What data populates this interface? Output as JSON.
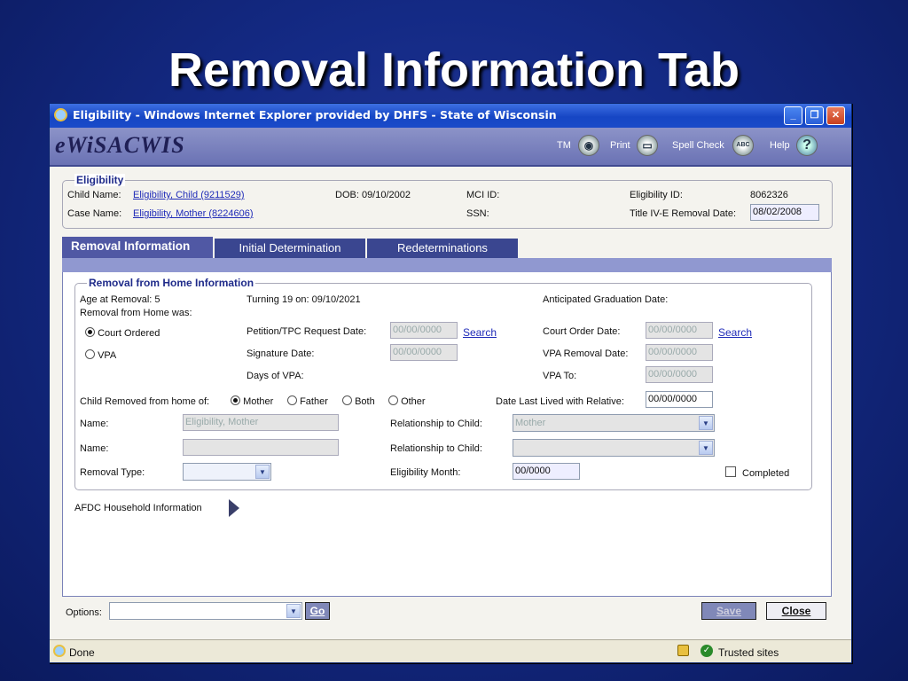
{
  "slide": {
    "title": "Removal Information Tab"
  },
  "window": {
    "title": "Eligibility - Windows Internet Explorer provided by DHFS - State of Wisconsin"
  },
  "app": {
    "logo": "eWiSACWIS",
    "toolbar": {
      "tm": "TM",
      "print": "Print",
      "spell": "Spell Check",
      "help": "Help"
    }
  },
  "header": {
    "legend": "Eligibility",
    "child_name_label": "Child Name:",
    "child_name": "Eligibility, Child (9211529)",
    "case_name_label": "Case Name:",
    "case_name": "Eligibility, Mother (8224606)",
    "dob": "DOB: 09/10/2002",
    "mci": "MCI ID:",
    "ssn": "SSN:",
    "elig_id_label": "Eligibility ID:",
    "elig_id": "8062326",
    "title4e_label": "Title IV-E Removal Date:",
    "title4e_value": "08/02/2008"
  },
  "tabs": {
    "removal": "Removal Information",
    "initial": "Initial Determination",
    "redet": "Redeterminations"
  },
  "removal": {
    "legend": "Removal from Home Information",
    "age": "Age at Removal: 5",
    "turning": "Turning 19 on: 09/10/2021",
    "anticipated": "Anticipated Graduation Date:",
    "removal_was": "Removal from Home was:",
    "court_ordered": "Court Ordered",
    "vpa": "VPA",
    "petition_label": "Petition/TPC Request Date:",
    "petition_value": "00/00/0000",
    "search1": "Search",
    "court_order_label": "Court Order Date:",
    "court_order_value": "00/00/0000",
    "search2": "Search",
    "signature_label": "Signature Date:",
    "signature_value": "00/00/0000",
    "vpa_removal_label": "VPA Removal Date:",
    "vpa_removal_value": "00/00/0000",
    "days_vpa": "Days of VPA:",
    "vpa_to_label": "VPA To:",
    "vpa_to_value": "00/00/0000",
    "removed_from": "Child Removed from home of:",
    "mother": "Mother",
    "father": "Father",
    "both": "Both",
    "other": "Other",
    "date_last_label": "Date Last Lived with Relative:",
    "date_last_value": "00/00/0000",
    "name_label": "Name:",
    "name1_value": "Eligibility, Mother",
    "name2_label": "Name:",
    "rel_label": "Relationship to Child:",
    "rel1_value": "Mother",
    "rel2_label": "Relationship to Child:",
    "removal_type_label": "Removal Type:",
    "elig_month_label": "Eligibility Month:",
    "elig_month_value": "00/0000",
    "completed": "Completed"
  },
  "afdc": {
    "label": "AFDC Household Information"
  },
  "footer": {
    "options_label": "Options:",
    "go": "Go",
    "save": "Save",
    "close": "Close"
  },
  "status": {
    "done": "Done",
    "zone": "Trusted sites"
  }
}
